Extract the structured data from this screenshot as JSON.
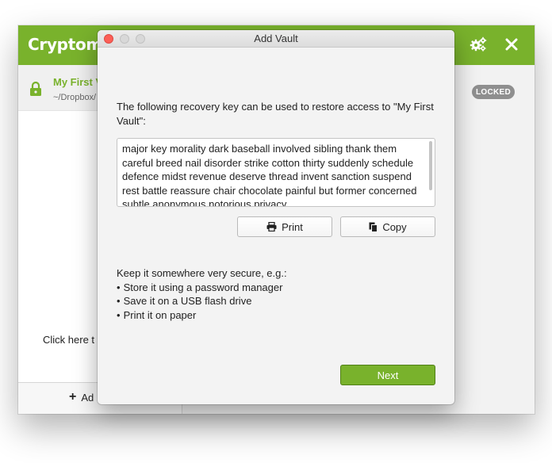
{
  "main": {
    "app_title": "Cryptomat",
    "settings_icon": "gears-icon",
    "close_icon": "close-icon",
    "sidebar": {
      "vault": {
        "name": "My First V",
        "path": "~/Dropbox/",
        "icon": "lock-icon"
      },
      "click_hint": "Click here t",
      "add_label": "Ad"
    },
    "status_badge": "LOCKED",
    "colors": {
      "accent": "#79b22c",
      "badge": "#8f8f8f"
    }
  },
  "dialog": {
    "title": "Add Vault",
    "intro": "The following recovery key can be used to restore access to \"My First Vault\":",
    "recovery_key": "major key morality dark baseball involved sibling thank them careful breed nail disorder strike cotton thirty suddenly schedule defence midst revenue deserve thread invent sanction suspend rest battle reassure chair chocolate painful but former concerned subtle anonymous notorious privacy",
    "print_label": "Print",
    "copy_label": "Copy",
    "advice_heading": "Keep it somewhere very secure, e.g.:",
    "advice_items": [
      "Store it using a password manager",
      "Save it on a USB flash drive",
      "Print it on paper"
    ],
    "next_label": "Next"
  }
}
